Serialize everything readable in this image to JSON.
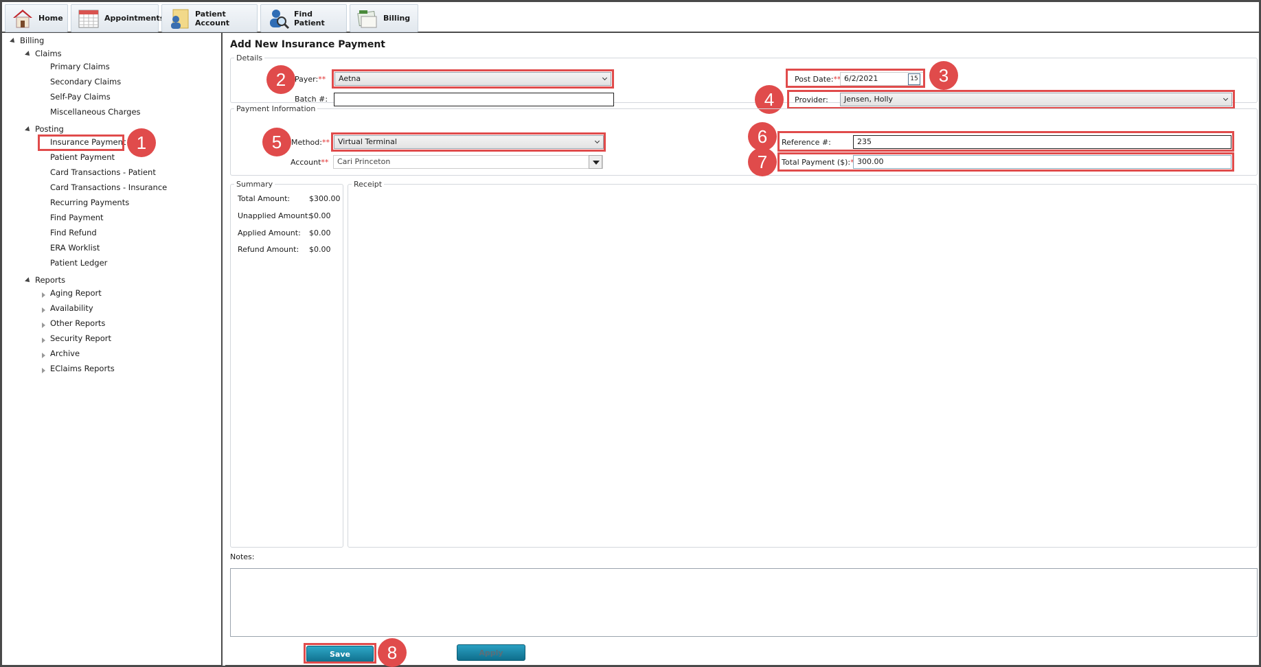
{
  "toolbar": {
    "home": "Home",
    "appointments": "Appointments",
    "patient_account": "Patient Account",
    "find_patient": "Find Patient",
    "billing": "Billing"
  },
  "tree": {
    "billing": "Billing",
    "claims": "Claims",
    "claims_items": [
      "Primary Claims",
      "Secondary Claims",
      "Self-Pay Claims",
      "Miscellaneous Charges"
    ],
    "posting": "Posting",
    "posting_items": [
      "Insurance Payment",
      "Patient Payment",
      "Card Transactions - Patient",
      "Card Transactions - Insurance",
      "Recurring Payments",
      "Find Payment",
      "Find Refund",
      "ERA Worklist",
      "Patient Ledger"
    ],
    "reports": "Reports",
    "reports_items": [
      "Aging Report",
      "Availability",
      "Other Reports",
      "Security Report",
      "Archive",
      "EClaims Reports"
    ]
  },
  "page": {
    "title": "Add New Insurance Payment",
    "details_legend": "Details",
    "payer_label": "Payer:",
    "payer_value": "Aetna",
    "batch_label": "Batch #:",
    "batch_value": "",
    "post_date_label": "Post Date:",
    "post_date_value": "6/2/2021",
    "calendar_day": "15",
    "provider_label": "Provider:",
    "provider_value": "Jensen, Holly",
    "payment_legend": "Payment Information",
    "method_label": "Method:",
    "method_value": "Virtual Terminal",
    "account_label": "Account",
    "account_value": "Cari Princeton",
    "reference_label": "Reference #:",
    "reference_value": "235",
    "total_payment_label": "Total Payment ($):",
    "total_payment_value": "300.00",
    "required_mark": "**",
    "summary_legend": "Summary",
    "summary": [
      {
        "label": "Total Amount:",
        "value": "$300.00"
      },
      {
        "label": "Unapplied Amount:",
        "value": "$0.00"
      },
      {
        "label": "Applied Amount:",
        "value": "$0.00"
      },
      {
        "label": "Refund Amount:",
        "value": "$0.00"
      }
    ],
    "receipt_legend": "Receipt",
    "notes_label": "Notes:",
    "notes_value": "",
    "save_label": "Save",
    "apply_label": "Apply"
  },
  "badges": [
    "1",
    "2",
    "3",
    "4",
    "5",
    "6",
    "7",
    "8"
  ],
  "colors": {
    "highlight": "#e04b4b",
    "button": "#1a8bad",
    "required": "#e03030"
  }
}
